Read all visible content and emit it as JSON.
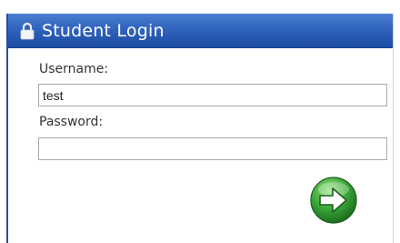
{
  "panel": {
    "title": "Student Login",
    "title_icon": "lock-icon"
  },
  "form": {
    "username_label": "Username:",
    "username_value": "test",
    "password_label": "Password:",
    "password_value": "",
    "submit_icon": "right-arrow-icon"
  },
  "colors": {
    "titlebar": "#2f63bd",
    "submit_green": "#2fa432"
  }
}
